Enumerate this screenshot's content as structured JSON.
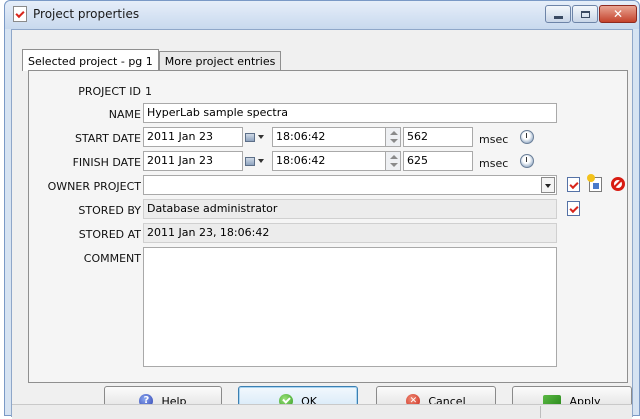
{
  "window": {
    "title": "Project properties"
  },
  "tabs": [
    {
      "label": "Selected project - pg 1",
      "active": true
    },
    {
      "label": "More project entries",
      "active": false
    }
  ],
  "form": {
    "project_id": {
      "label": "PROJECT ID",
      "value": "1"
    },
    "name": {
      "label": "NAME",
      "value": "HyperLab sample spectra"
    },
    "start_date": {
      "label": "START DATE",
      "date": "2011 Jan 23",
      "time": "18:06:42",
      "msec": "562",
      "unit": "msec"
    },
    "finish_date": {
      "label": "FINISH DATE",
      "date": "2011 Jan 23",
      "time": "18:06:42",
      "msec": "625",
      "unit": "msec"
    },
    "owner_project": {
      "label": "OWNER PROJECT",
      "value": ""
    },
    "stored_by": {
      "label": "STORED BY",
      "value": "Database administrator"
    },
    "stored_at": {
      "label": "STORED AT",
      "value": "2011 Jan 23, 18:06:42"
    },
    "comment": {
      "label": "COMMENT",
      "value": ""
    }
  },
  "buttons": {
    "help": "Help",
    "ok": "OK",
    "cancel": "Cancel",
    "apply": "Apply"
  },
  "colors": {
    "title_bar": "#c8d9ee",
    "close_button": "#c4422c",
    "default_button_border": "#3c7fb1"
  },
  "icons": {
    "help": "help-icon",
    "ok": "checkmark-icon",
    "cancel": "cancel-icon",
    "apply": "apply-icon"
  }
}
